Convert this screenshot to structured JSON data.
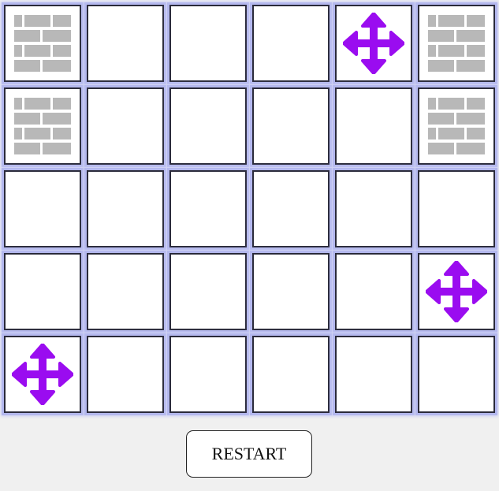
{
  "board": {
    "rows": 5,
    "cols": 6,
    "cells": [
      [
        "wall",
        "empty",
        "empty",
        "empty",
        "move",
        "wall"
      ],
      [
        "wall",
        "empty",
        "empty",
        "empty",
        "empty",
        "wall"
      ],
      [
        "empty",
        "empty",
        "empty",
        "empty",
        "empty",
        "empty"
      ],
      [
        "empty",
        "empty",
        "empty",
        "empty",
        "empty",
        "move"
      ],
      [
        "move",
        "empty",
        "empty",
        "empty",
        "empty",
        "empty"
      ]
    ]
  },
  "icons": {
    "wall": "brick-wall-icon",
    "move": "move-arrows-icon"
  },
  "colors": {
    "brick": "#b8b8b8",
    "move": "#9a0cf0"
  },
  "controls": {
    "restart_label": "RESTART"
  }
}
